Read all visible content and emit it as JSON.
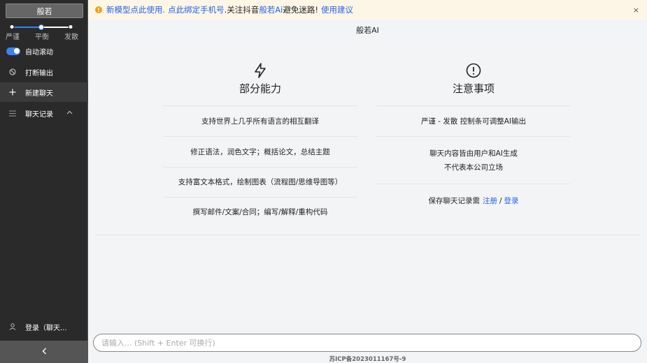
{
  "sidebar": {
    "brand_button": "般若",
    "slider": {
      "labels": [
        "严谨",
        "平衡",
        "发散"
      ],
      "value_index": 1
    },
    "items": [
      {
        "icon": "toggle-icon",
        "label": "自动滚动"
      },
      {
        "icon": "stop-icon",
        "label": "打断输出"
      },
      {
        "icon": "plus-icon",
        "label": "新建聊天"
      },
      {
        "icon": "list-icon",
        "label": "聊天记录"
      }
    ],
    "login_label": "登录（聊天...",
    "collapse_icon": "chevron-left-icon"
  },
  "banner": {
    "text_a": "新模型点此使用.",
    "text_b": "点此绑定手机号",
    "text_c": ".关注抖音",
    "text_d": "般若Ai",
    "text_e": "避免迷路!",
    "text_f": "使用建议",
    "close": "×"
  },
  "main": {
    "title": "般若AI",
    "left": {
      "title": "部分能力",
      "items": [
        "支持世界上几乎所有语言的相互翻译",
        "修正语法，润色文字；概括论文，总结主题",
        "支持富文本格式，绘制图表（流程图/思维导图等）",
        "撰写邮件/文案/合同；编写/解释/重构代码"
      ]
    },
    "right": {
      "title": "注意事项",
      "item1": "严谨 - 发散 控制条可调整AI输出",
      "item2_line1": "聊天内容皆由用户和AI生成",
      "item2_line2": "不代表本公司立场",
      "item3_text": "保存聊天记录需",
      "item3_register": "注册",
      "item3_sep": "/",
      "item3_login": "登录"
    }
  },
  "input": {
    "placeholder": "请输入... (Shift + Enter 可换行)"
  },
  "footer": "苏ICP备2023011167号-9",
  "colors": {
    "accent": "#3b82f6",
    "link": "#2563eb",
    "warning": "#f59e0b",
    "sidebar_bg": "#2a2a2a"
  }
}
